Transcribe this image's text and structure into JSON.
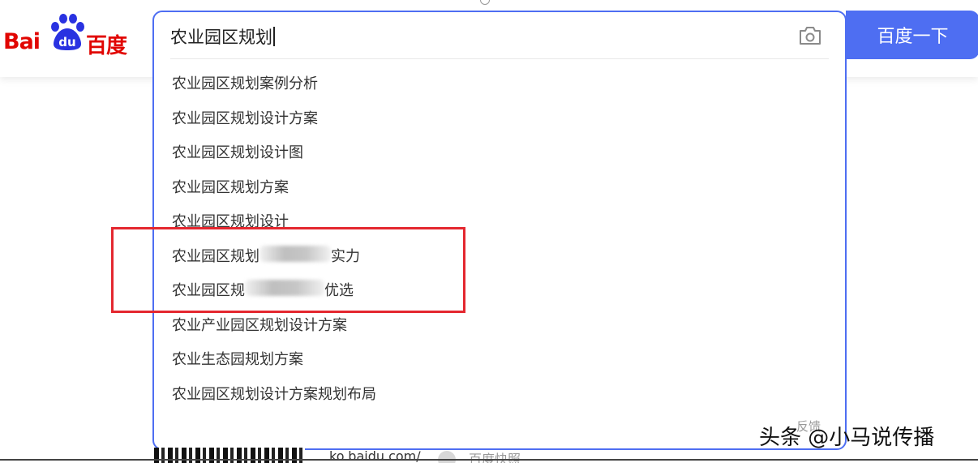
{
  "header": {
    "logo": {
      "latin": "Bai",
      "cn": "百度"
    }
  },
  "search": {
    "query": "农业园区规划",
    "button_label": "百度一下",
    "suggestions": [
      {
        "text": "农业园区规划案例分析"
      },
      {
        "text": "农业园区规划设计方案"
      },
      {
        "text": "农业园区规划设计图"
      },
      {
        "text": "农业园区规划方案"
      },
      {
        "text": "农业园区规划设计"
      },
      {
        "prefix": "农业园区规划",
        "suffix": "实力",
        "obscured": true
      },
      {
        "prefix": "农业园区规",
        "suffix": "优选",
        "obscured": true
      },
      {
        "text": "农业产业园区规划设计方案"
      },
      {
        "text": "农业生态园规划方案"
      },
      {
        "text": "农业园区规划设计方案规划布局"
      }
    ],
    "feedback_label": "反馈"
  },
  "results": {
    "url": "ko.baidu.com/",
    "snapshot_label": "百度快照"
  },
  "watermark": "头条 @小马说传播",
  "icons": [
    "baidu-paw-icon",
    "camera-icon",
    "snapshot-icon"
  ],
  "colors": {
    "brand_red": "#e10602",
    "accent_blue": "#4e6ef2",
    "annotation_red": "#e4272f"
  }
}
